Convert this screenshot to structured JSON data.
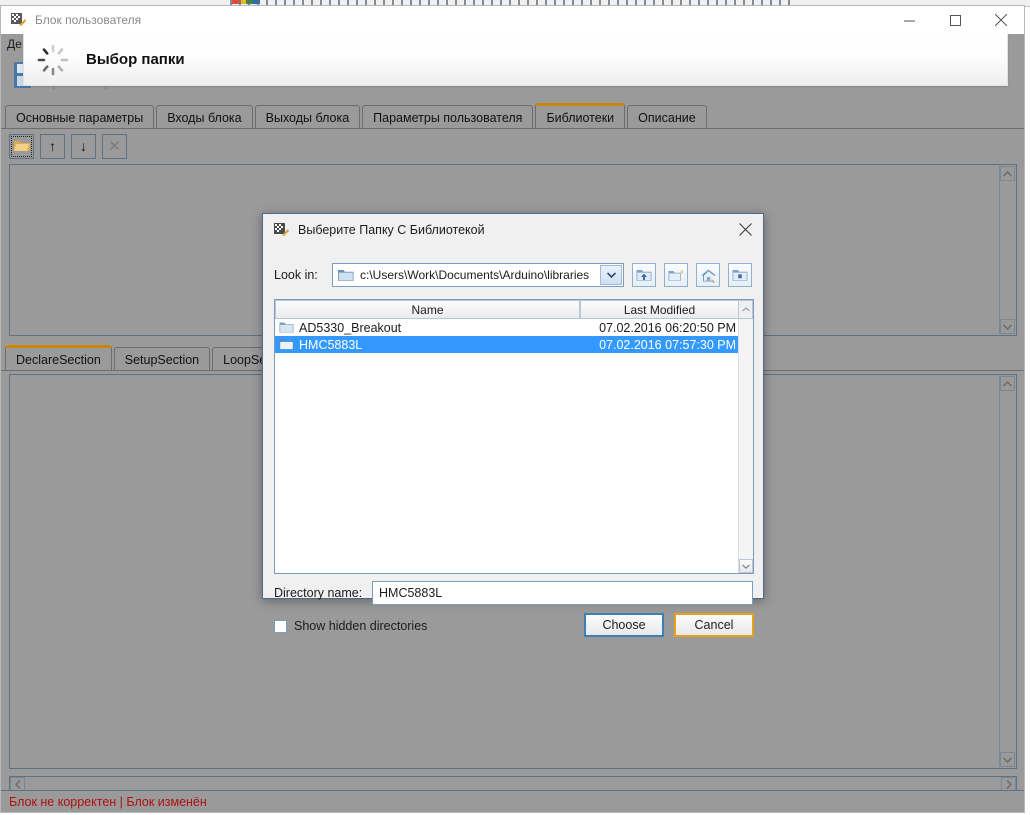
{
  "window": {
    "title": "Блок пользователя",
    "title_icon": "app-icon",
    "buttons": {
      "minimize": "minimize-icon",
      "maximize": "maximize-icon",
      "close": "close-icon"
    },
    "menu": [
      {
        "label": "Де"
      }
    ]
  },
  "splash": {
    "text": "Выбор папки",
    "icon": "spinner-icon"
  },
  "tabs": [
    {
      "label": "Основные параметры",
      "active": false
    },
    {
      "label": "Входы блока",
      "active": false
    },
    {
      "label": "Выходы блока",
      "active": false
    },
    {
      "label": "Параметры пользователя",
      "active": false
    },
    {
      "label": "Библиотеки",
      "active": true
    },
    {
      "label": "Описание",
      "active": false
    }
  ],
  "library_toolbar": [
    {
      "name": "open-folder-button",
      "icon": "folder-open-icon",
      "label": "",
      "focused": true,
      "disabled": false
    },
    {
      "name": "move-up-button",
      "icon": "arrow-up-icon",
      "label": "↑",
      "focused": false,
      "disabled": false
    },
    {
      "name": "move-down-button",
      "icon": "arrow-down-icon",
      "label": "↓",
      "focused": false,
      "disabled": false
    },
    {
      "name": "delete-button",
      "icon": "close-x-icon",
      "label": "✕",
      "focused": false,
      "disabled": true
    }
  ],
  "section_tabs": [
    {
      "label": "DeclareSection",
      "active": true
    },
    {
      "label": "SetupSection",
      "active": false
    },
    {
      "label": "LoopSect",
      "active": false
    }
  ],
  "statusbar": {
    "text": "Блок не корректен | Блок изменён",
    "color": "#b01010"
  },
  "dialog": {
    "title": "Выберите Папку С Библиотекой",
    "title_icon": "app-icon",
    "close_icon": "close-icon",
    "lookin": {
      "label": "Look in:",
      "value": "c:\\Users\\Work\\Documents\\Arduino\\libraries",
      "folder_icon": "folder-icon",
      "dropdown_icon": "chevron-down-icon"
    },
    "toolbar": [
      {
        "name": "parent-directory-button",
        "icon": "folder-up-icon"
      },
      {
        "name": "new-folder-button",
        "icon": "folder-new-icon"
      },
      {
        "name": "home-button",
        "icon": "home-icon"
      },
      {
        "name": "detail-view-button",
        "icon": "detail-view-icon"
      }
    ],
    "filelist": {
      "columns": [
        "Name",
        "Last Modified"
      ],
      "rows": [
        {
          "name": "AD5330_Breakout",
          "modified": "07.02.2016 06:20:50 PM",
          "selected": false,
          "icon": "folder-icon"
        },
        {
          "name": "HMC5883L",
          "modified": "07.02.2016 07:57:30 PM",
          "selected": true,
          "icon": "folder-icon"
        }
      ],
      "scroll_up_icon": "chevron-up-icon",
      "scroll_down_icon": "chevron-down-icon"
    },
    "directory_name": {
      "label": "Directory name:",
      "value": "HMC5883L",
      "placeholder": ""
    },
    "show_hidden": {
      "label": "Show hidden directories",
      "checked": false
    },
    "actions": {
      "choose": "Choose",
      "cancel": "Cancel"
    },
    "colors": {
      "selection": "#3399ff",
      "default_button_border": "#3c7fb1",
      "hover_button_border": "#e5a219"
    }
  },
  "scrollbars": {
    "up_icon": "chevron-up-icon",
    "down_icon": "chevron-down-icon",
    "left_icon": "chevron-left-icon",
    "right_icon": "chevron-right-icon"
  }
}
